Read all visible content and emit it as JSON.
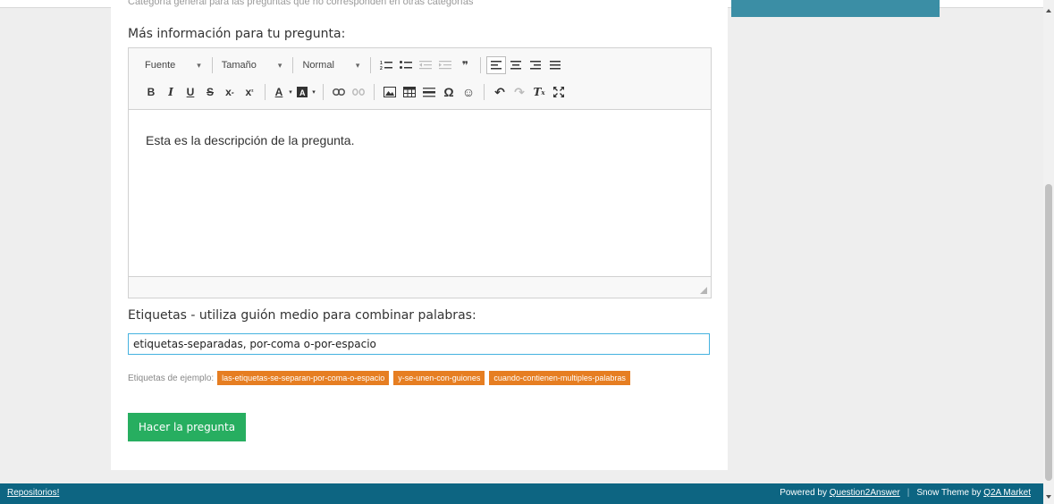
{
  "header": {
    "cut_text": "Categoría general para las preguntas que no corresponden en otras categorías"
  },
  "form": {
    "description_label": "Más información para tu pregunta:",
    "tags_label": "Etiquetas - utiliza guión medio para combinar palabras:",
    "tags_value": "etiquetas-separadas, por-coma o-por-espacio",
    "example_label": "Etiquetas de ejemplo:",
    "example_tags": [
      "las-etiquetas-se-separan-por-coma-o-espacio",
      "y-se-unen-con-guiones",
      "cuando-contienen-multiples-palabras"
    ],
    "submit_label": "Hacer la pregunta"
  },
  "editor": {
    "font_combo": "Fuente",
    "size_combo": "Tamaño",
    "format_combo": "Normal",
    "content": "Esta es la descripción de la pregunta.",
    "icons_row1": [
      "numbered-list-icon",
      "bulleted-list-icon",
      "outdent-icon",
      "indent-icon",
      "blockquote-icon",
      "align-left-icon",
      "align-center-icon",
      "align-right-icon",
      "justify-icon"
    ],
    "icons_row2": [
      "bold-icon",
      "italic-icon",
      "underline-icon",
      "strike-icon",
      "subscript-icon",
      "superscript-icon",
      "text-color-icon",
      "bg-color-icon",
      "link-icon",
      "unlink-icon",
      "image-icon",
      "table-icon",
      "horizontal-rule-icon",
      "special-char-icon",
      "smiley-icon",
      "undo-icon",
      "redo-icon",
      "remove-format-icon",
      "maximize-icon"
    ]
  },
  "footer": {
    "left_link": "Repositorios!",
    "powered_prefix": "Powered by",
    "powered_link": "Question2Answer",
    "theme_prefix": "Snow Theme by",
    "theme_link": "Q2A Market"
  },
  "colors": {
    "tag": "#e67e22",
    "submit": "#27ae60",
    "footer": "#0d6582",
    "sidebar_button": "#3b8ea5",
    "input_focus": "#45b2e0"
  }
}
